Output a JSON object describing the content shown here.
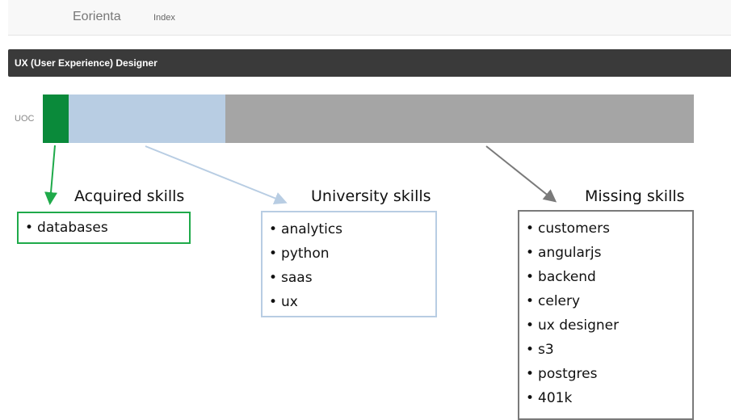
{
  "nav": {
    "brand": "Eorienta",
    "link": "Index"
  },
  "title": "UX (User Experience) Designer",
  "uoc": {
    "label": "UOC",
    "acquired_fraction": 0.04,
    "university_fraction": 0.24,
    "missing_fraction": 0.72,
    "colors": {
      "acquired": "#0a8a3a",
      "university": "#b8cde3",
      "missing": "#a5a5a5"
    }
  },
  "acquired": {
    "heading": "Acquired skills",
    "items": [
      "databases"
    ]
  },
  "university": {
    "heading": "University skills",
    "items": [
      "analytics",
      "python",
      "saas",
      "ux"
    ]
  },
  "missing": {
    "heading": "Missing skills",
    "items": [
      "customers",
      "angularjs",
      "backend",
      "celery",
      "ux designer",
      "s3",
      "postgres",
      "401k"
    ]
  }
}
